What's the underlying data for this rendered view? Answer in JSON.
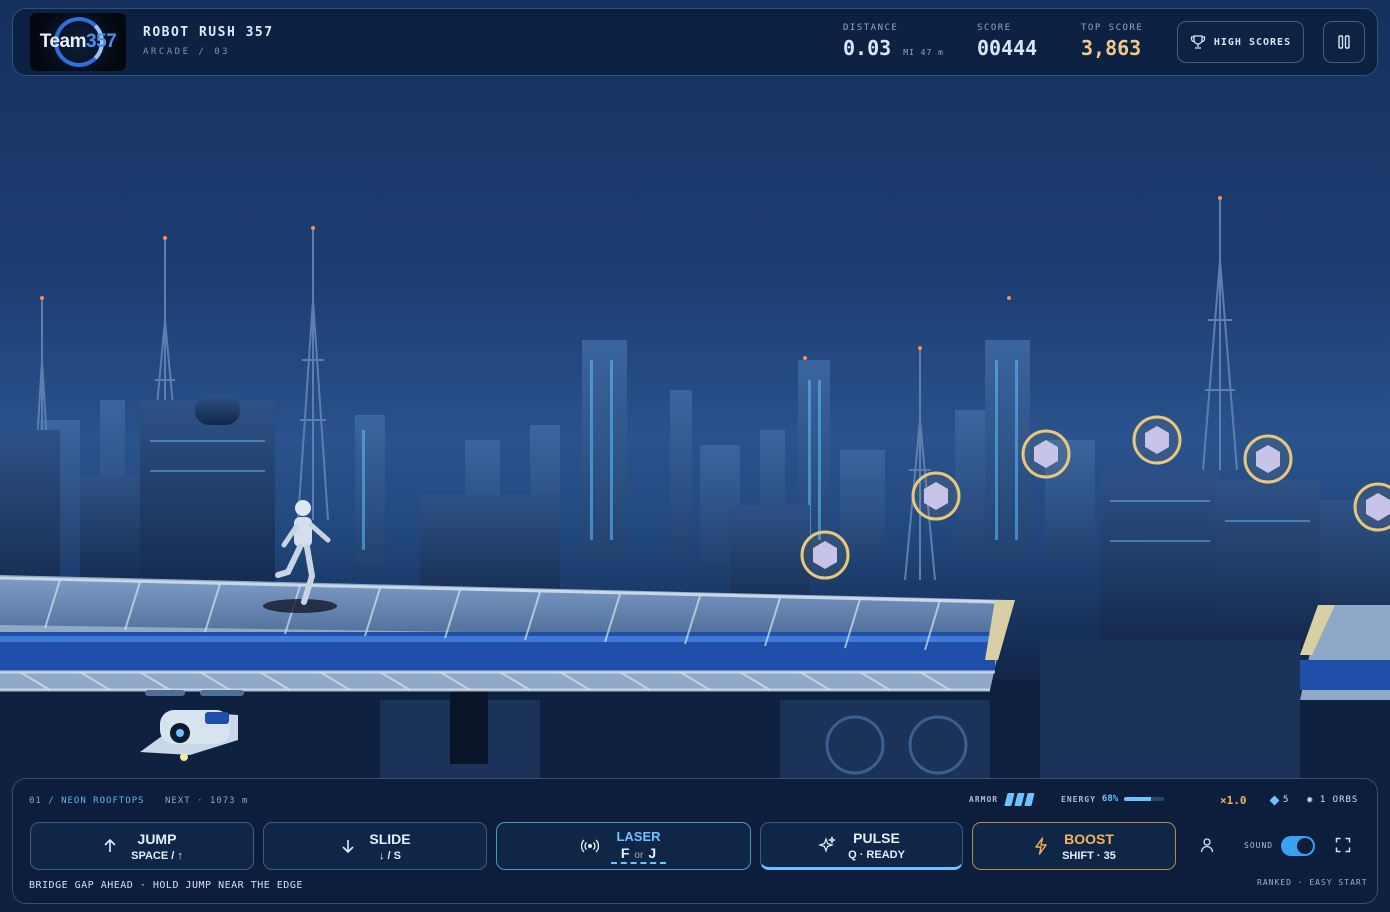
{
  "header": {
    "logo_text_a": "Team",
    "logo_text_b": "357",
    "title": "ROBOT RUSH 357",
    "subtitle": "ARCADE / 03",
    "distance_label": "DISTANCE",
    "distance_value": "0.03",
    "distance_unit": "MI 47 m",
    "score_label": "SCORE",
    "score_value": "00444",
    "top_score_label": "TOP SCORE",
    "top_score_value": "3,863",
    "high_scores_label": "HIGH SCORES",
    "icons": {
      "high_scores": "trophy-icon",
      "pause": "pause-icon"
    }
  },
  "scene": {
    "orb_count_visible": 6,
    "colors": {
      "sky_top": "#15305e",
      "orb_ring": "#e8c77a",
      "orb_gem": "#c8c4e8",
      "rail": "#1f4fa8"
    }
  },
  "footer": {
    "level": "01 / NEON ROOFTOPS",
    "next": "NEXT · 1073 m",
    "armor_label": "ARMOR",
    "armor_pips": 3,
    "energy_label": "ENERGY",
    "energy_value": "68%",
    "energy_fraction": 0.68,
    "multiplier": "×1.0",
    "gems": "5",
    "orbs": "1 ORBS",
    "actions": [
      {
        "name": "JUMP",
        "key": "SPACE / ↑",
        "icon": "arrow-up-icon"
      },
      {
        "name": "SLIDE",
        "key": "↓ / S",
        "icon": "arrow-down-icon"
      },
      {
        "name": "LASER",
        "key_a": "F",
        "key_or": "or",
        "key_b": "J",
        "icon": "broadcast-icon"
      },
      {
        "name": "PULSE",
        "key": "Q · READY",
        "icon": "sparkle-icon"
      },
      {
        "name": "BOOST",
        "key": "SHIFT · 35",
        "icon": "lightning-icon"
      }
    ],
    "sound_label": "SOUND",
    "sound_on": true,
    "hint": "BRIDGE GAP AHEAD · HOLD JUMP NEAR THE EDGE",
    "mode": "RANKED · EASY START",
    "icons": {
      "profile": "user-icon",
      "fullscreen": "fullscreen-icon"
    },
    "colors": {
      "accent": "#6ec3ff",
      "boost": "#f3b35a",
      "score_top": "#f3c98a"
    }
  }
}
